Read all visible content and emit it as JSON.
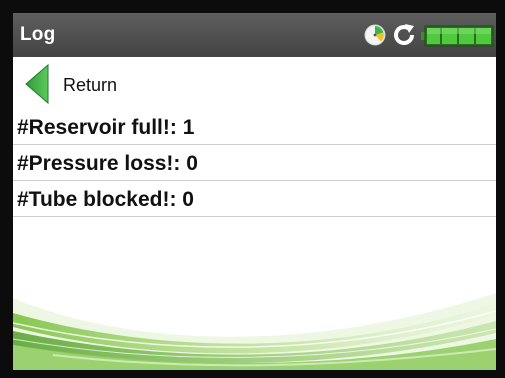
{
  "header": {
    "title": "Log"
  },
  "status_icons": [
    "clock-icon",
    "refresh-icon",
    "battery-icon"
  ],
  "colors": {
    "titlebar": "#4e4e4e",
    "accent_green": "#3cb648",
    "battery_green": "#4fc93d",
    "frame": "#0c0c0c"
  },
  "nav": {
    "return_label": "Return"
  },
  "log_entries": [
    {
      "text": "#Reservoir full!: 1"
    },
    {
      "text": "#Pressure loss!: 0"
    },
    {
      "text": "#Tube blocked!: 0"
    }
  ]
}
